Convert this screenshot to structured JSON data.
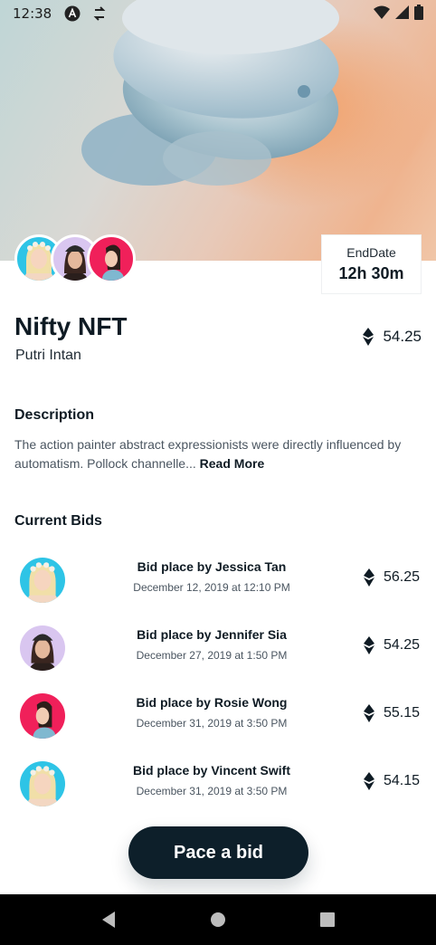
{
  "status_bar": {
    "time": "12:38",
    "icons": [
      "app-a-icon",
      "sync-icon",
      "wifi-icon",
      "signal-icon",
      "battery-icon"
    ]
  },
  "nft": {
    "title": "Nifty NFT",
    "author": "Putri Intan",
    "price": "54.25",
    "currency_icon": "ethereum-icon"
  },
  "end_date": {
    "label": "EndDate",
    "value": "12h 30m"
  },
  "description": {
    "heading": "Description",
    "text": "The action painter abstract expressionists were directly influenced by automatism. Pollock channelle...",
    "read_more": "Read More"
  },
  "bids": {
    "heading": "Current Bids",
    "items": [
      {
        "name": "Bid place by Jessica Tan",
        "date": "December 12, 2019 at 12:10 PM",
        "amount": "56.25",
        "avatar_bg": "#2ec4e6"
      },
      {
        "name": "Bid place by Jennifer Sia",
        "date": "December 27, 2019 at 1:50 PM",
        "amount": "54.25",
        "avatar_bg": "#d9c6f0"
      },
      {
        "name": "Bid place by Rosie Wong",
        "date": "December 31, 2019 at 3:50 PM",
        "amount": "55.15",
        "avatar_bg": "#f0205a"
      },
      {
        "name": "Bid place by Vincent Swift",
        "date": "December 31, 2019 at 3:50 PM",
        "amount": "54.15",
        "avatar_bg": "#2ec4e6"
      }
    ]
  },
  "cta": {
    "label": "Pace a bid"
  },
  "colors": {
    "primary": "#0d1f2a",
    "text": "#0f1b24",
    "muted": "#4a5560"
  }
}
